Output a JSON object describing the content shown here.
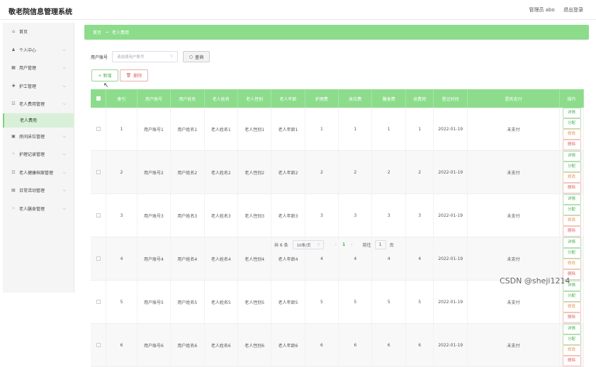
{
  "app": {
    "title": "敬老院信息管理系统",
    "user": "管理员 abo",
    "logout": "退出登录"
  },
  "sidebar": {
    "items": [
      {
        "icon": "⌂",
        "label": "首页",
        "chev": false
      },
      {
        "icon": "♟",
        "label": "个人中心",
        "chev": true
      },
      {
        "icon": "▦",
        "label": "用户管理",
        "chev": true
      },
      {
        "icon": "✚",
        "label": "护工管理",
        "chev": true
      },
      {
        "icon": "☷",
        "label": "老人费用管理",
        "chev": true
      }
    ],
    "sub": "老人费用",
    "items2": [
      {
        "icon": "▣",
        "label": "房间床位管理",
        "chev": true
      },
      {
        "icon": "⁘",
        "label": "护理记录管理",
        "chev": true
      },
      {
        "icon": "☷",
        "label": "老人健康档案管理",
        "chev": true
      },
      {
        "icon": "▤",
        "label": "日常活动管理",
        "chev": true
      },
      {
        "icon": "⁘",
        "label": "老人膳食管理",
        "chev": true
      }
    ]
  },
  "breadcrumb": {
    "home": "首页",
    "sep": "→",
    "current": "老人费用"
  },
  "search": {
    "label": "用户账号",
    "placeholder": "请选择用户账号",
    "button": "查询"
  },
  "actions": {
    "add": "+ 新增",
    "delete": "删除"
  },
  "table": {
    "headers": [
      "索引",
      "用户账号",
      "用户姓名",
      "老人姓名",
      "老人性别",
      "老人年龄",
      "护理费",
      "床位费",
      "膳食费",
      "总费用",
      "登记时间",
      "是否支付",
      "操作"
    ],
    "rows": [
      {
        "idx": "1",
        "acct": "用户账号1",
        "uname": "用户姓名1",
        "ename": "老人姓名1",
        "gender": "老人性别1",
        "age": "老人年龄1",
        "care": "1",
        "bed": "1",
        "meal": "1",
        "total": "1",
        "date": "2022-01-19",
        "paid": "未支付"
      },
      {
        "idx": "2",
        "acct": "用户账号2",
        "uname": "用户姓名2",
        "ename": "老人姓名2",
        "gender": "老人性别2",
        "age": "老人年龄2",
        "care": "2",
        "bed": "2",
        "meal": "2",
        "total": "2",
        "date": "2022-01-19",
        "paid": "未支付"
      },
      {
        "idx": "3",
        "acct": "用户账号3",
        "uname": "用户姓名3",
        "ename": "老人姓名3",
        "gender": "老人性别3",
        "age": "老人年龄3",
        "care": "3",
        "bed": "3",
        "meal": "3",
        "total": "3",
        "date": "2022-01-19",
        "paid": "未支付"
      },
      {
        "idx": "4",
        "acct": "用户账号4",
        "uname": "用户姓名4",
        "ename": "老人姓名4",
        "gender": "老人性别4",
        "age": "老人年龄4",
        "care": "4",
        "bed": "4",
        "meal": "4",
        "total": "4",
        "date": "2022-01-19",
        "paid": "未支付"
      },
      {
        "idx": "5",
        "acct": "用户账号5",
        "uname": "用户姓名5",
        "ename": "老人姓名5",
        "gender": "老人性别5",
        "age": "老人年龄5",
        "care": "5",
        "bed": "5",
        "meal": "5",
        "total": "5",
        "date": "2022-01-19",
        "paid": "未支付"
      },
      {
        "idx": "6",
        "acct": "用户账号6",
        "uname": "用户姓名6",
        "ename": "老人姓名6",
        "gender": "老人性别6",
        "age": "老人年龄6",
        "care": "6",
        "bed": "6",
        "meal": "6",
        "total": "6",
        "date": "2022-01-19",
        "paid": "未支付"
      }
    ],
    "ops": {
      "view": "详情",
      "assign": "分配",
      "edit": "修改",
      "remove": "删除"
    }
  },
  "pager": {
    "total": "共 6 条",
    "size": "10条/页",
    "prev": "‹",
    "page": "1",
    "next": "›",
    "goto": "前往",
    "goto_val": "1",
    "unit": "页"
  },
  "watermark": "CSDN @sheji1214",
  "colors": {
    "accent": "#8cdc8c",
    "danger": "#e06666",
    "warn": "#e09050"
  }
}
